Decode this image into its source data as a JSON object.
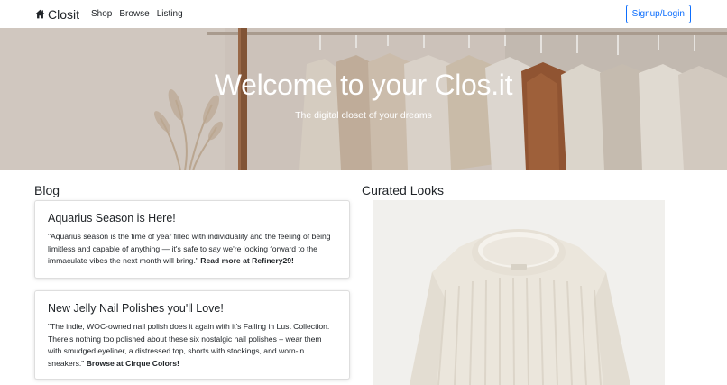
{
  "navbar": {
    "brand": "Closit",
    "links": [
      "Shop",
      "Browse",
      "Listing"
    ],
    "signup_label": "Signup/Login",
    "accent_color": "#0d6efd"
  },
  "hero": {
    "title": "Welcome to your Clos.it",
    "subtitle": "The digital closet of your dreams"
  },
  "blog": {
    "heading": "Blog",
    "posts": [
      {
        "title": "Aquarius Season is Here!",
        "text": "\"Aquarius season is the time of year filled with individuality and the feeling of being limitless and capable of anything — it's safe to say we're looking forward to the immaculate vibes the next month will bring.\"",
        "link": "Read more at Refinery29!"
      },
      {
        "title": "New Jelly Nail Polishes you'll Love!",
        "text": "\"The indie, WOC-owned nail polish does it again with it's Falling in Lust Collection. There's nothing too polished about these six nostalgic nail polishes – wear them with smudged eyeliner, a distressed top, shorts with stockings, and worn-in sneakers.\"",
        "link": "Browse at Cirque Colors!"
      }
    ]
  },
  "curated": {
    "heading": "Curated Looks",
    "image_icon": "cream-knit-sweater-image"
  }
}
